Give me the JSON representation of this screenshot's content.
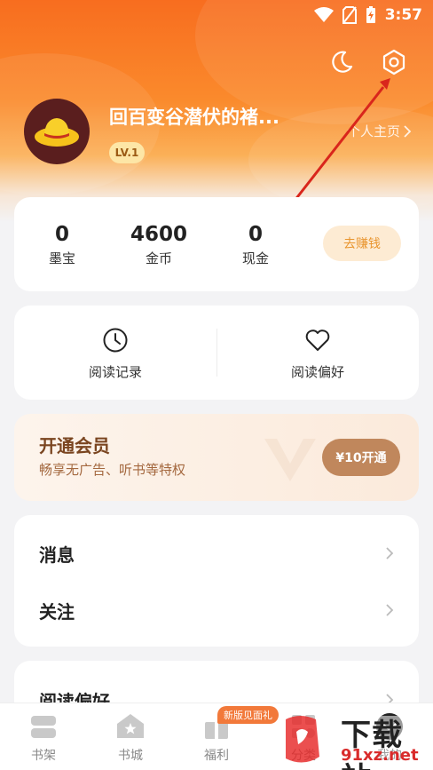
{
  "status_bar": {
    "time": "3:57"
  },
  "profile": {
    "username": "回百变谷潜伏的褚...",
    "level": "LV.1",
    "home_link": "个人主页"
  },
  "stats": [
    {
      "value": "0",
      "label": "墨宝"
    },
    {
      "value": "4600",
      "label": "金币"
    },
    {
      "value": "0",
      "label": "现金"
    }
  ],
  "earn_button": "去赚钱",
  "quick_actions": [
    {
      "label": "阅读记录",
      "icon": "clock-icon"
    },
    {
      "label": "阅读偏好",
      "icon": "heart-icon"
    }
  ],
  "vip": {
    "title": "开通会员",
    "subtitle": "畅享无广告、听书等特权",
    "button": "¥10开通"
  },
  "menu": [
    {
      "label": "消息"
    },
    {
      "label": "关注"
    },
    {
      "label": "阅读偏好"
    }
  ],
  "bottom_nav": {
    "items": [
      {
        "label": "书架",
        "icon": "bookshelf-icon"
      },
      {
        "label": "书城",
        "icon": "bookstore-icon"
      },
      {
        "label": "福利",
        "icon": "gift-icon"
      },
      {
        "label": "分类",
        "icon": "category-icon"
      },
      {
        "label": "我的",
        "icon": "profile-icon"
      }
    ],
    "badge": "新版见面礼"
  },
  "watermark": {
    "text": "下载站",
    "url": "91xz.net"
  },
  "colors": {
    "header_orange": "#f86d1f",
    "earn_text": "#e9952f",
    "vip_button": "#c0875c",
    "annotation_arrow": "#d9261c"
  }
}
